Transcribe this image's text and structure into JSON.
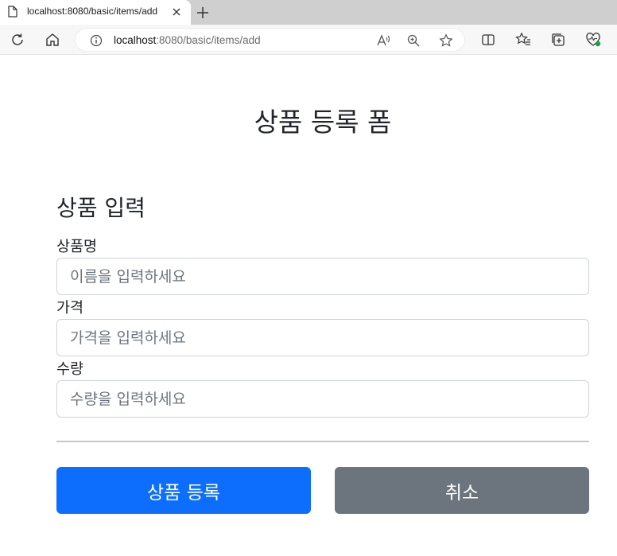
{
  "browser": {
    "tab_title": "localhost:8080/basic/items/add",
    "address_host": "localhost",
    "address_rest": ":8080/basic/items/add"
  },
  "page": {
    "title": "상품 등록 폼",
    "section_title": "상품 입력"
  },
  "form": {
    "name_label": "상품명",
    "name_placeholder": "이름을 입력하세요",
    "price_label": "가격",
    "price_placeholder": "가격을 입력하세요",
    "quantity_label": "수량",
    "quantity_placeholder": "수량을 입력하세요"
  },
  "buttons": {
    "submit_label": "상품 등록",
    "cancel_label": "취소"
  },
  "colors": {
    "primary": "#0d6efd",
    "secondary": "#6c757d"
  }
}
